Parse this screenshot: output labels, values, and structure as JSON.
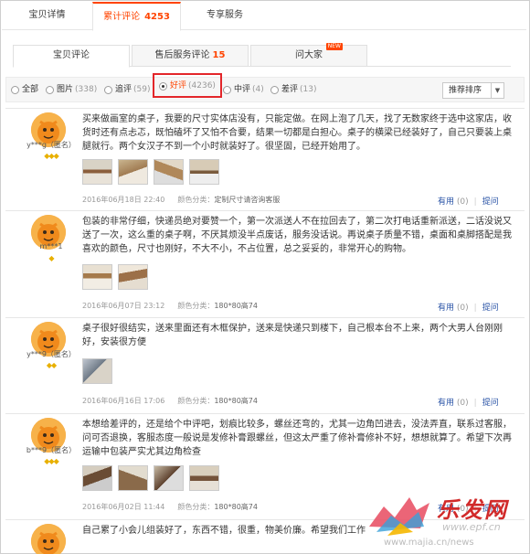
{
  "top_tabs": [
    {
      "label": "宝贝详情"
    },
    {
      "label": "累计评论",
      "count": "4253"
    },
    {
      "label": "专享服务"
    }
  ],
  "sub_tabs": [
    {
      "label": "宝贝评论"
    },
    {
      "label": "售后服务评论",
      "count": "15"
    },
    {
      "label": "问大家",
      "badge": "NEW"
    }
  ],
  "filters": [
    {
      "label": "全部",
      "count": ""
    },
    {
      "label": "图片",
      "count": "(338)"
    },
    {
      "label": "追评",
      "count": "(59)"
    },
    {
      "label": "好评",
      "count": "(4236)"
    },
    {
      "label": "中评",
      "count": "(4)"
    },
    {
      "label": "差评",
      "count": "(13)"
    }
  ],
  "sort": {
    "label": "推荐排序"
  },
  "reviews": [
    {
      "user": "y***g（匿名）",
      "medals": "◆◆◆",
      "text": "买来做画室的桌子，我要的尺寸实体店没有，只能定做。在网上泡了几天，找了无数家终于选中这家店，收货时还有点忐忑，既怕磕坏了又怕不合要，结果一切都是白担心。桌子的横梁已经装好了，自己只要装上桌腿就行。两个女汉子不到一个小时就装好了。很坚固，已经开始用了。",
      "date": "2016年06月18日 22:40",
      "sku_label": "颜色分类：",
      "sku_value": "定制尺寸请咨询客服",
      "useful": "有用",
      "useful_count": "(0)",
      "reply": "提问"
    },
    {
      "user": "m***1",
      "medals": "◆",
      "text": "包装的非常仔细，快递员绝对要赞一个，第一次派送人不在拉回去了，第二次打电话重新派送，二话没说又送了一次，这么重的桌子啊，不厌其烦没半点废话，服务没话说。再说桌子质量不错，桌面和桌脚搭配是我喜欢的颜色，尺寸也刚好，不大不小，不占位置，总之妥妥的，非常开心的购物。",
      "date": "2016年06月07日 23:12",
      "sku_label": "颜色分类：",
      "sku_value": "180*80高74",
      "useful": "有用",
      "useful_count": "(0)",
      "reply": "提问"
    },
    {
      "user": "y***9（匿名）",
      "medals": "◆◆",
      "text": "桌子很好很结实，送来里面还有木框保护，送来是快递只到楼下，自己根本台不上来，两个大男人台刚刚好，安装很方便",
      "date": "2016年06月16日 17:06",
      "sku_label": "颜色分类：",
      "sku_value": "180*80高74",
      "useful": "有用",
      "useful_count": "(0)",
      "reply": "提问"
    },
    {
      "user": "b***9（匿名）",
      "medals": "◆◆◆",
      "text": "本想给差评的，还是给个中评吧，划痕比较多，螺丝还弯的，尤其一边角凹进去，没法弄直，联系过客服，问可否退换，客服态度一般说是发修补膏跟螺丝，但这太严重了修补膏修补不好，想想就算了。希望下次再运输中包装严实尤其边角检查",
      "date": "2016年06月02日 11:44",
      "sku_label": "颜色分类：",
      "sku_value": "180*80高74",
      "useful": "有用",
      "useful_count": "(0)",
      "reply": "提问"
    },
    {
      "user": "",
      "medals": "",
      "text": "自己累了小会儿组装好了，东西不错，很重，物美价廉。希望我们工作",
      "date": "",
      "sku_label": "",
      "sku_value": "",
      "useful": "",
      "useful_count": "",
      "reply": ""
    }
  ],
  "watermark": {
    "title": "乐发网",
    "url": "www.epf.cn",
    "url2": "www.majia.cn/news"
  }
}
